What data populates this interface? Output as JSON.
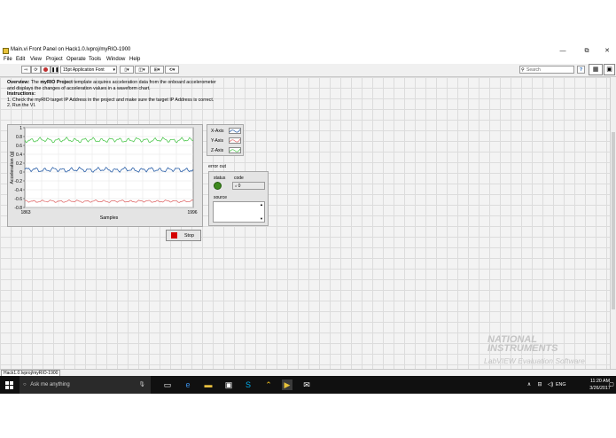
{
  "window": {
    "title": "Main.vi Front Panel on Hack1.0.lvproj/myRIO-1900",
    "minimize": "—",
    "restore": "⧉",
    "close": "✕"
  },
  "menu": [
    "File",
    "Edit",
    "View",
    "Project",
    "Operate",
    "Tools",
    "Window",
    "Help"
  ],
  "toolbar": {
    "font": "15pt Application Font",
    "search_placeholder": "Search",
    "help": "?"
  },
  "description": {
    "overview_label": "Overview:",
    "the": "The",
    "project_name": "myRIO Project",
    "line1_rest": "template acquires acceleration data from the onboard accelerometer",
    "line2": "and displays the changes of acceleration values in a waveform chart.",
    "instructions_label": "Instructions:",
    "step1": "1. Check the myRIO target IP Address in the project and make sure the target IP Address is correct.",
    "step2": "2. Run the VI."
  },
  "chart_data": {
    "type": "line",
    "title": "",
    "xlabel": "Samples",
    "ylabel": "Acceleration (g)",
    "xlim": [
      1863,
      1996
    ],
    "ylim": [
      -0.8,
      1
    ],
    "yticks": [
      "1",
      "0.8",
      "0.6",
      "0.4",
      "0.2",
      "0",
      "-0.2",
      "-0.4",
      "-0.6",
      "-0.8"
    ],
    "xticks": [
      "1863",
      "1996"
    ],
    "series": [
      {
        "name": "X-Axis",
        "color": "#2a5fa8",
        "center": 0.05,
        "amplitude": 0.06
      },
      {
        "name": "Y-Axis",
        "color": "#e07070",
        "center": -0.66,
        "amplitude": 0.03
      },
      {
        "name": "Z-Axis",
        "color": "#50c850",
        "center": 0.72,
        "amplitude": 0.06
      }
    ],
    "grid": true,
    "legend": "right"
  },
  "error_out": {
    "label": "error out",
    "status_label": "status",
    "code_label": "code",
    "code_value": "0",
    "source_label": "source",
    "status_color": "#3e8a1e"
  },
  "stop_button": {
    "label": "Stop",
    "color": "#d40000"
  },
  "watermark": {
    "line1": "NATIONAL",
    "line2": "INSTRUMENTS",
    "line3": "LabVIEW Evaluation Software"
  },
  "statusbar": {
    "path": "Hack1.0.lvproj/myRIO-1900"
  },
  "taskbar": {
    "search": "Ask me anything",
    "language": "ENG",
    "time": "11:20 AM",
    "date": "3/26/2017"
  }
}
